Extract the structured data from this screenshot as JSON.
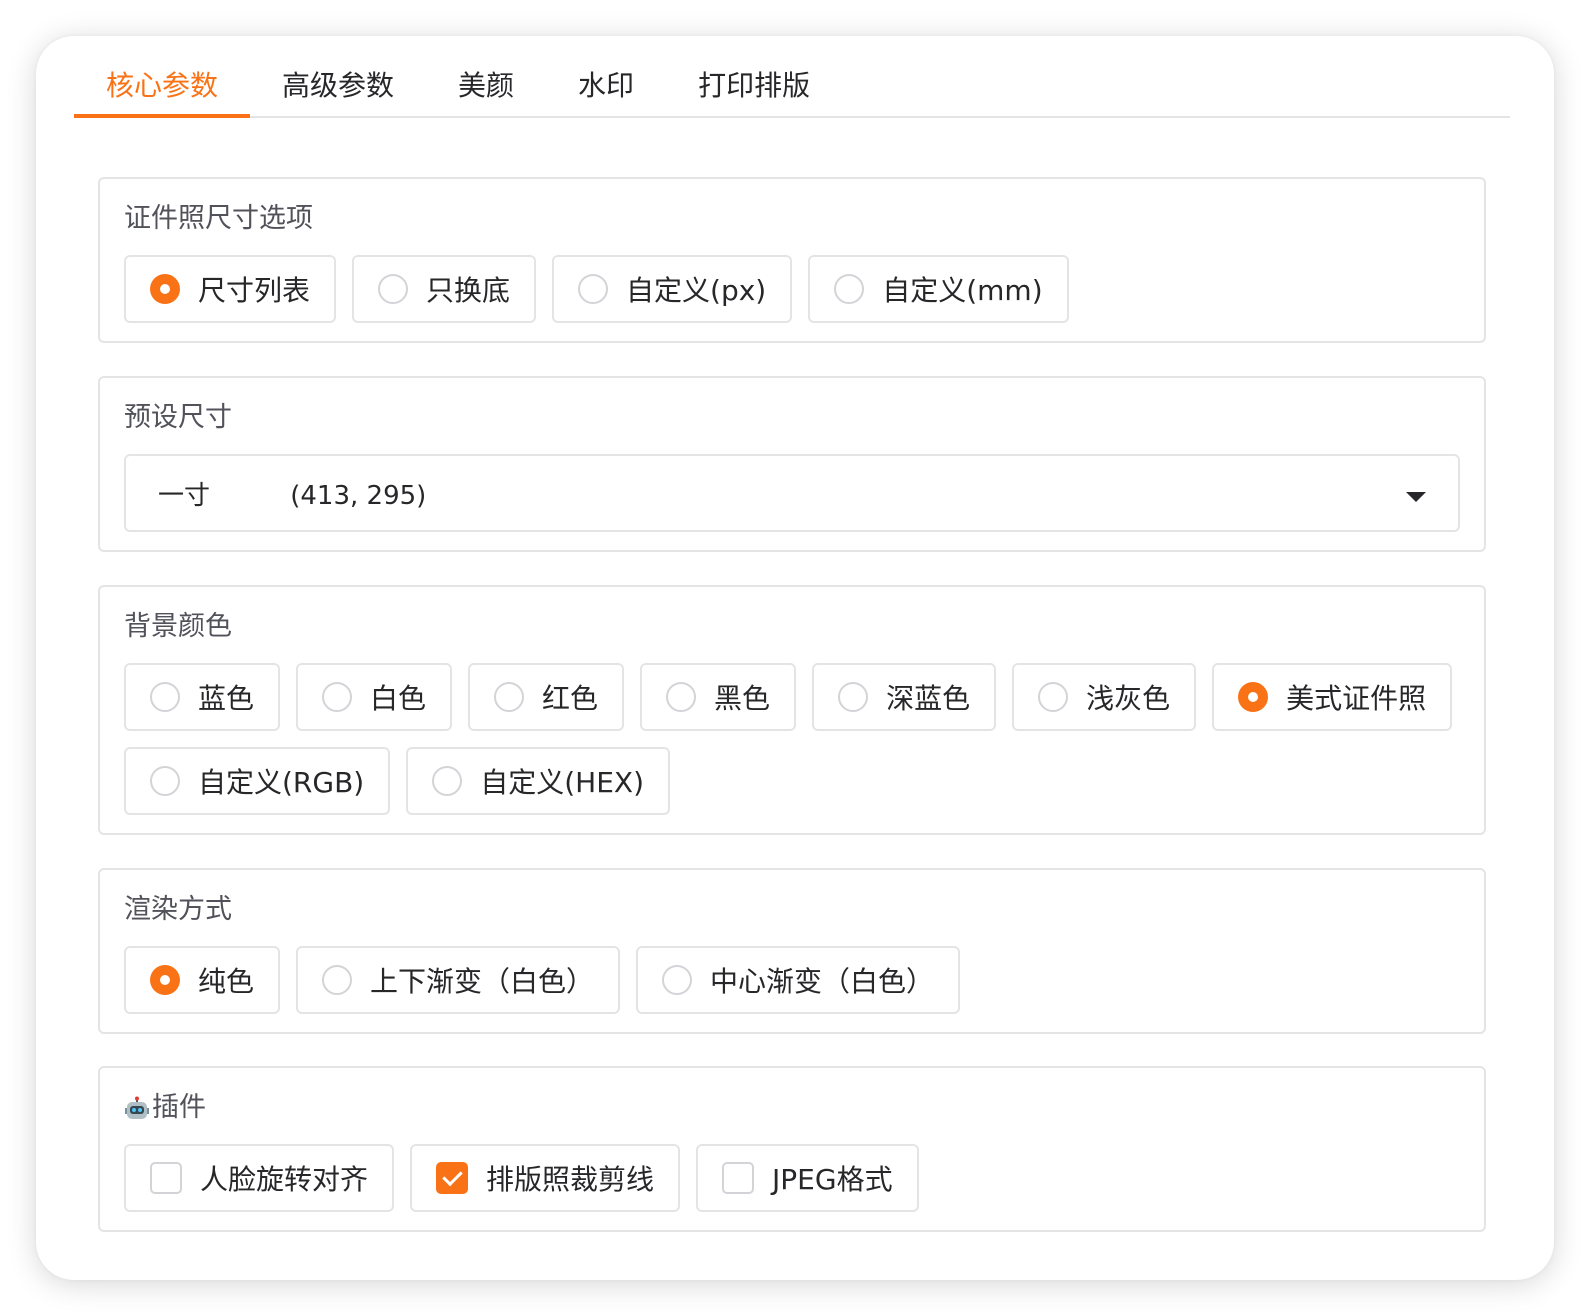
{
  "tabs": [
    {
      "label": "核心参数",
      "active": true
    },
    {
      "label": "高级参数",
      "active": false
    },
    {
      "label": "美颜",
      "active": false
    },
    {
      "label": "水印",
      "active": false
    },
    {
      "label": "打印排版",
      "active": false
    }
  ],
  "size_options": {
    "label": "证件照尺寸选项",
    "items": [
      "尺寸列表",
      "只换底",
      "自定义(px)",
      "自定义(mm)"
    ],
    "selected": "尺寸列表"
  },
  "preset_size": {
    "label": "预设尺寸",
    "value": "一寸\t\t(413, 295)"
  },
  "background_color": {
    "label": "背景颜色",
    "items": [
      "蓝色",
      "白色",
      "红色",
      "黑色",
      "深蓝色",
      "浅灰色",
      "美式证件照",
      "自定义(RGB)",
      "自定义(HEX)"
    ],
    "selected": "美式证件照"
  },
  "render_mode": {
    "label": "渲染方式",
    "items": [
      "纯色",
      "上下渐变（白色）",
      "中心渐变（白色）"
    ],
    "selected": "纯色"
  },
  "plugins": {
    "icon": "robot-icon",
    "label": "插件",
    "items": [
      {
        "label": "人脸旋转对齐",
        "checked": false
      },
      {
        "label": "排版照裁剪线",
        "checked": true
      },
      {
        "label": "JPEG格式",
        "checked": false
      }
    ]
  },
  "colors": {
    "accent": "#f97316",
    "border": "#e4e4e7",
    "label": "#52525b"
  }
}
